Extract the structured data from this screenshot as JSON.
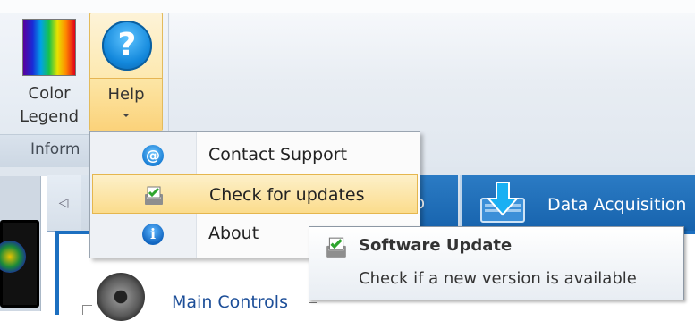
{
  "ribbon": {
    "group_label": "Inform",
    "color_legend": {
      "line1": "Color",
      "line2": "Legend",
      "icon": "spectrum-icon"
    },
    "help": {
      "label": "Help",
      "icon": "question-icon",
      "glyph": "?"
    }
  },
  "help_menu": {
    "items": [
      {
        "label": "Contact Support",
        "icon": "at-sign-icon",
        "glyph": "@"
      },
      {
        "label": "Check for updates",
        "icon": "download-check-icon"
      },
      {
        "label": "About",
        "icon": "info-icon",
        "glyph": "i"
      }
    ]
  },
  "tabs": {
    "scroll_left_glyph": "◁",
    "partial_label": "p",
    "data_acquisition": "Data Acquisition"
  },
  "tooltip": {
    "title": "Software Update",
    "description": "Check if a new version is available"
  },
  "content": {
    "section_title": "Main Controls"
  },
  "colors": {
    "accent_blue": "#1c6fc0",
    "highlight": "#fbdc8c"
  }
}
